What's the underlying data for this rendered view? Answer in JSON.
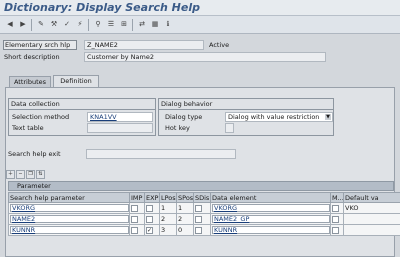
{
  "window": {
    "title": "Dictionary: Display Search Help"
  },
  "toolbar": {
    "buttons": [
      "back-arrow-icon",
      "forward-arrow-icon",
      "other-object-icon",
      "display-change-icon",
      "check-icon",
      "activate-icon",
      "where-used-icon",
      "object-list-icon",
      "hierarchy-icon",
      "navigate-icon",
      "display-icon",
      "info-icon"
    ]
  },
  "header": {
    "elementary_label": "Elementary srch hlp",
    "search_help_name": "Z_NAME2",
    "status": "Active",
    "short_desc_label": "Short description",
    "short_desc_value": "Customer by Name2"
  },
  "tabs": [
    {
      "label": "Attributes",
      "active": false
    },
    {
      "label": "Definition",
      "active": true
    }
  ],
  "data_collection": {
    "title": "Data collection",
    "selection_method_label": "Selection method",
    "selection_method_value": "KNA1VV",
    "text_table_label": "Text table",
    "text_table_value": ""
  },
  "dialog_behavior": {
    "title": "Dialog behavior",
    "dialog_type_label": "Dialog type",
    "dialog_type_value": "Dialog with value restriction",
    "hot_key_label": "Hot key",
    "hot_key_value": ""
  },
  "search_help_exit": {
    "label": "Search help exit",
    "value": ""
  },
  "grid": {
    "caption": "Parameter",
    "toolbar": [
      "insert-row-icon",
      "delete-row-icon",
      "copy-row-icon",
      "sort-icon"
    ],
    "columns": [
      "Search help parameter",
      "IMP",
      "EXP",
      "LPos",
      "SPos",
      "SDis",
      "Data element",
      "M...",
      "Default va"
    ],
    "rows": [
      {
        "param": "VKORG",
        "imp": false,
        "exp": false,
        "lpos": "1",
        "spos": "1",
        "sdis": false,
        "data_element": "VKORG",
        "mod": false,
        "default": "VKO"
      },
      {
        "param": "NAME2",
        "imp": false,
        "exp": false,
        "lpos": "2",
        "spos": "2",
        "sdis": false,
        "data_element": "NAME2_GP",
        "mod": false,
        "default": ""
      },
      {
        "param": "KUNNR",
        "imp": false,
        "exp": true,
        "lpos": "3",
        "spos": "0",
        "sdis": false,
        "data_element": "KUNNR",
        "mod": false,
        "default": ""
      }
    ]
  },
  "colors": {
    "title": "#3b5b88",
    "background": "#d4d7dc",
    "panel": "#dfe2e6",
    "grid_header": "#c7ced6"
  }
}
